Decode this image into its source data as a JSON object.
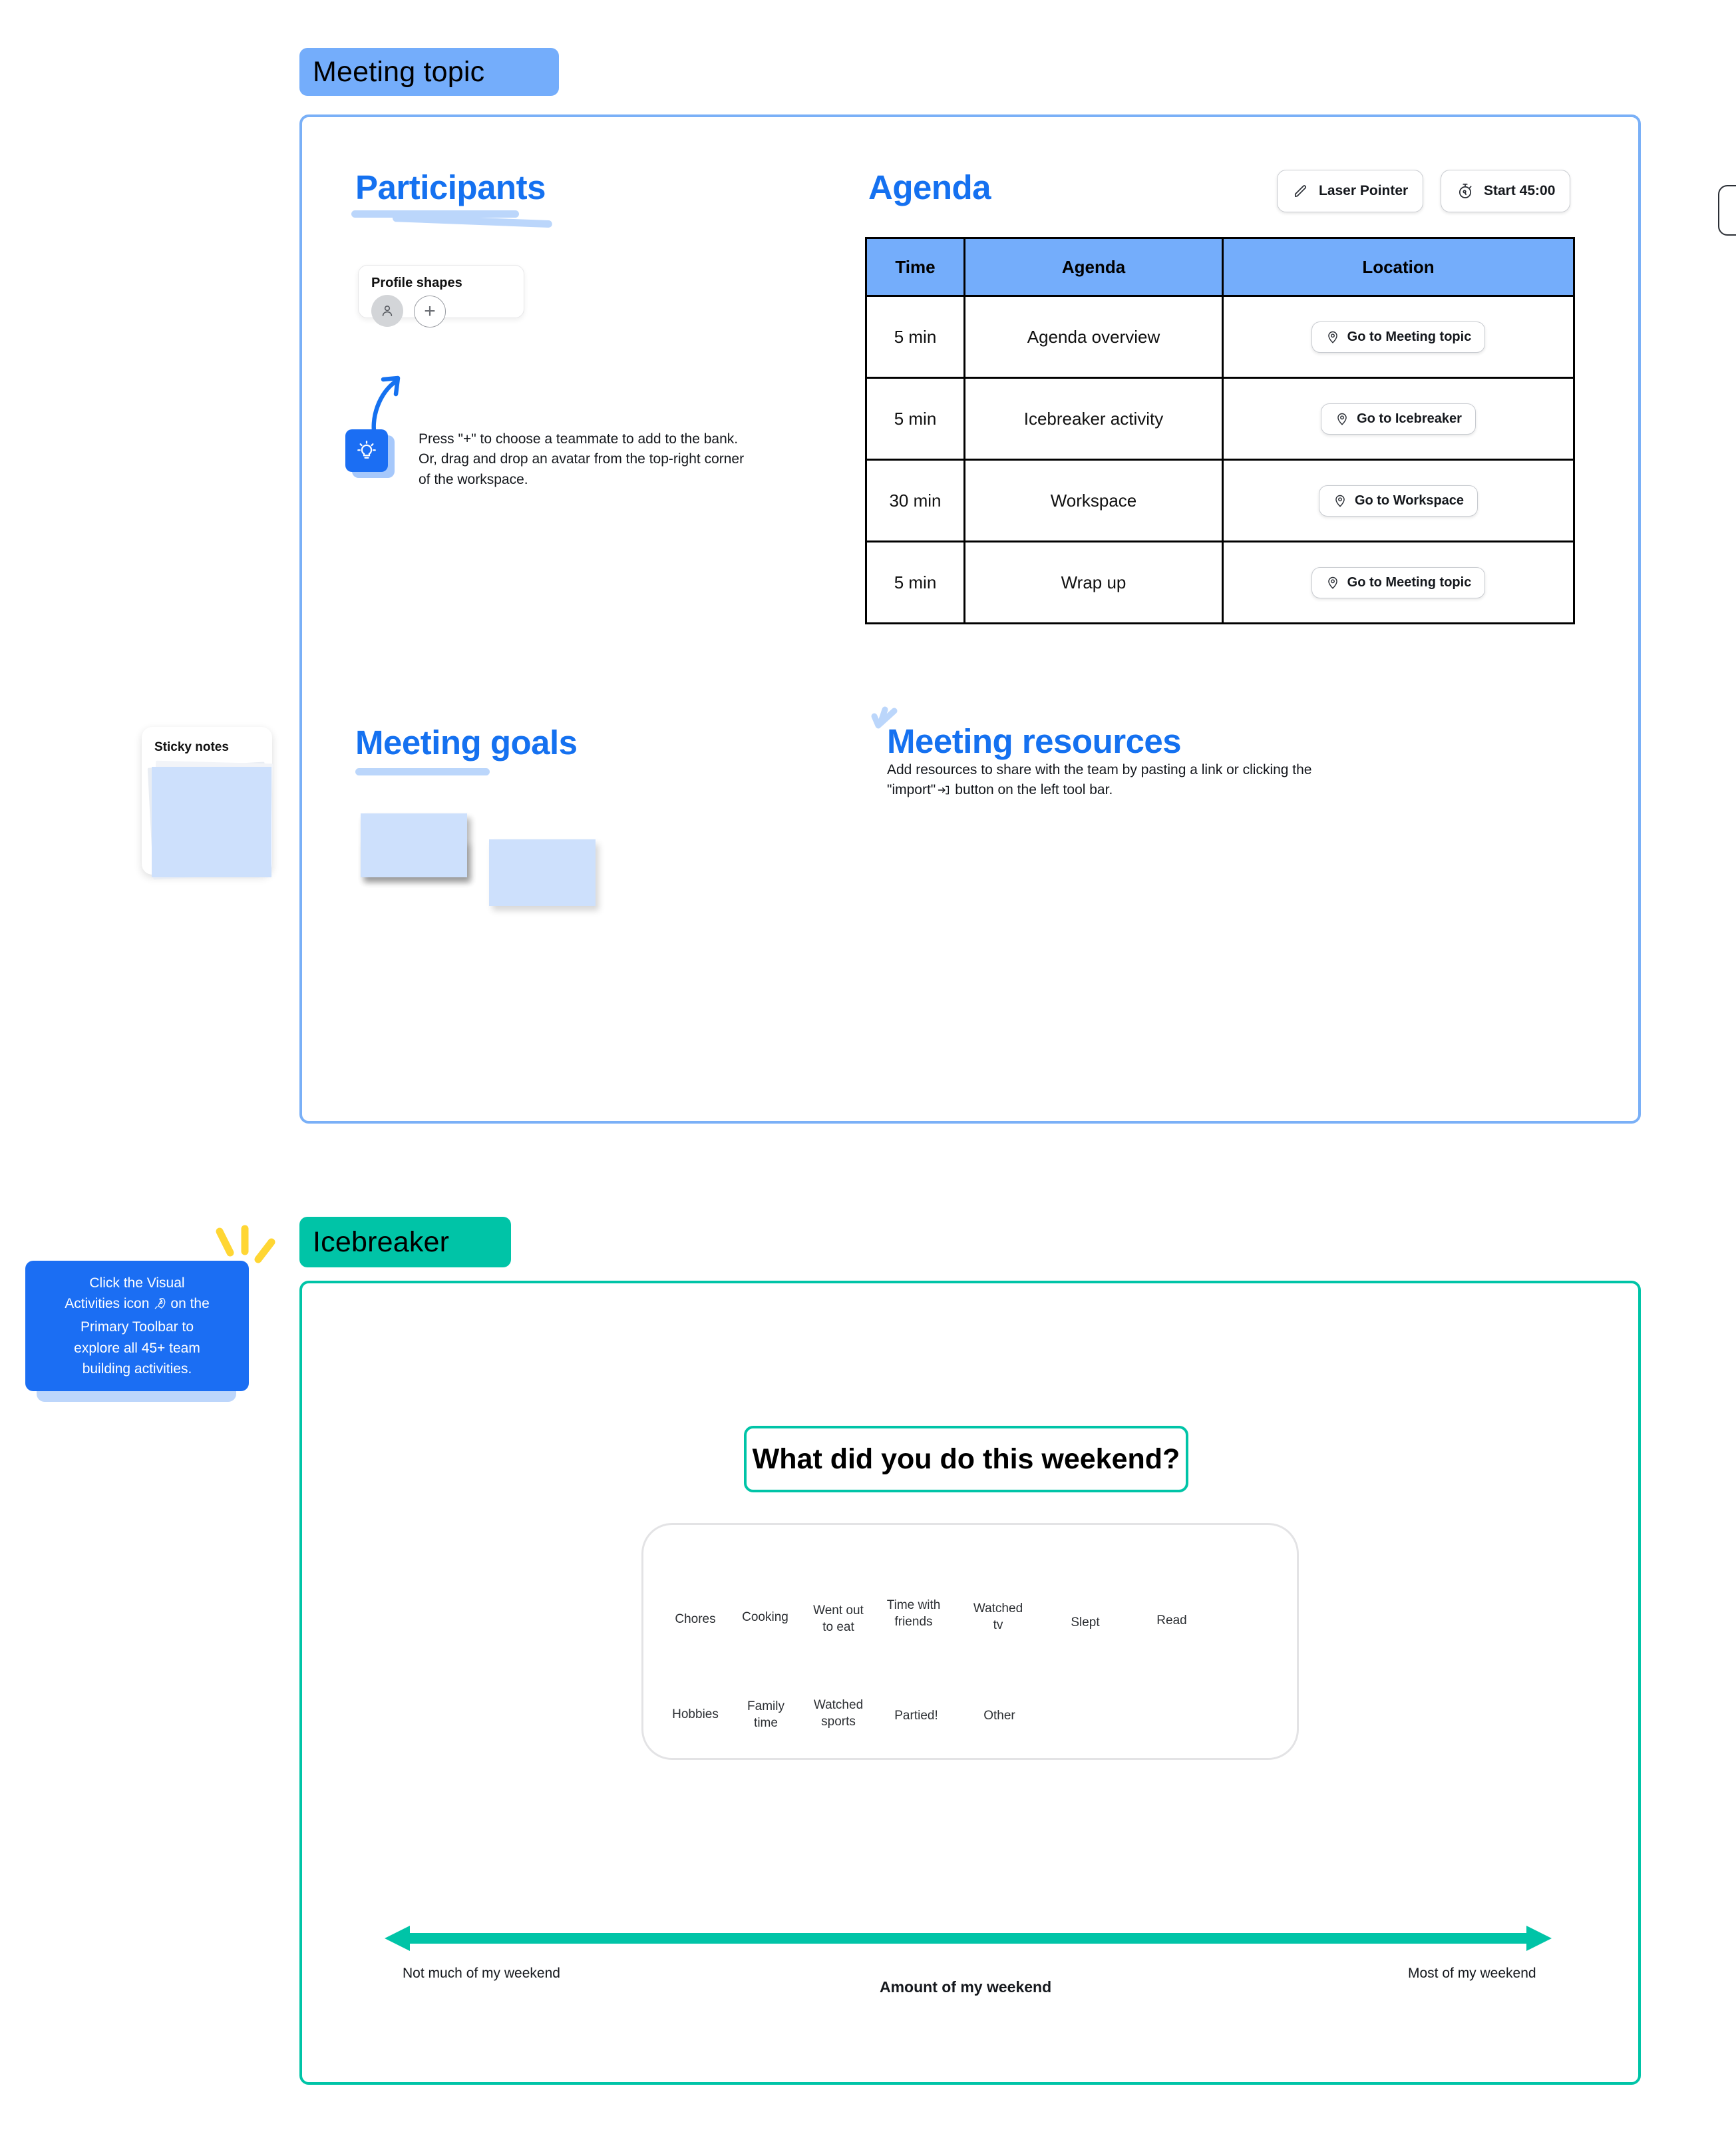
{
  "frames": {
    "meeting_topic": {
      "title": "Meeting topic",
      "color": "#74ADFB"
    },
    "icebreaker": {
      "title": "Icebreaker",
      "color": "#00C4A7"
    }
  },
  "participants": {
    "heading": "Participants",
    "profile_card": {
      "title": "Profile shapes",
      "avatar_icon": "person-icon",
      "add_icon": "plus-icon"
    },
    "hint": {
      "icon": "lightbulb-icon",
      "text": "Press \"+\" to choose a teammate to add to the bank. Or, drag and drop an avatar from the top-right corner of the workspace."
    }
  },
  "agenda": {
    "heading": "Agenda",
    "toolbar": [
      {
        "label": "Laser Pointer",
        "icon": "pen-icon"
      },
      {
        "label": "Start 45:00",
        "icon": "stopwatch-icon"
      }
    ],
    "columns": [
      "Time",
      "Agenda",
      "Location"
    ],
    "rows": [
      {
        "time": "5 min",
        "agenda": "Agenda overview",
        "location": "Go to Meeting topic",
        "icon": "map-pin-icon"
      },
      {
        "time": "5 min",
        "agenda": "Icebreaker activity",
        "location": "Go to Icebreaker",
        "icon": "map-pin-icon"
      },
      {
        "time": "30 min",
        "agenda": "Workspace",
        "location": "Go to Workspace",
        "icon": "map-pin-icon"
      },
      {
        "time": "5 min",
        "agenda": "Wrap up",
        "location": "Go to Meeting topic",
        "icon": "map-pin-icon"
      }
    ]
  },
  "meeting_goals": {
    "heading": "Meeting goals"
  },
  "meeting_resources": {
    "heading": "Meeting resources",
    "line1": "Add resources to share with the team by pasting a link or clicking the",
    "line2_pre": "\"import\"",
    "line2_icon": "import-icon",
    "line2_post": "button on the left tool bar."
  },
  "sticky_notes_card": {
    "title": "Sticky notes"
  },
  "icebreaker": {
    "tooltip": {
      "line1": "Click the Visual",
      "line2_pre": "Activities icon",
      "line2_icon": "rocket-icon",
      "line2_post": "on the",
      "line3": "Primary Toolbar to",
      "line4": "explore all 45+ team",
      "line5": "building activities."
    },
    "question": "What did you do this weekend?",
    "answer_bank": {
      "row1": [
        "Chores",
        "Cooking",
        "Went out\nto eat",
        "Time with\nfriends",
        "Watched\ntv",
        "Slept",
        "Read"
      ],
      "row2": [
        "Hobbies",
        "Family\ntime",
        "Watched\nsports",
        "Partied!",
        "Other"
      ]
    },
    "axis": {
      "left_label": "Not much of my weekend",
      "right_label": "Most of my weekend",
      "caption": "Amount of my weekend",
      "color": "#00C4A7"
    }
  }
}
